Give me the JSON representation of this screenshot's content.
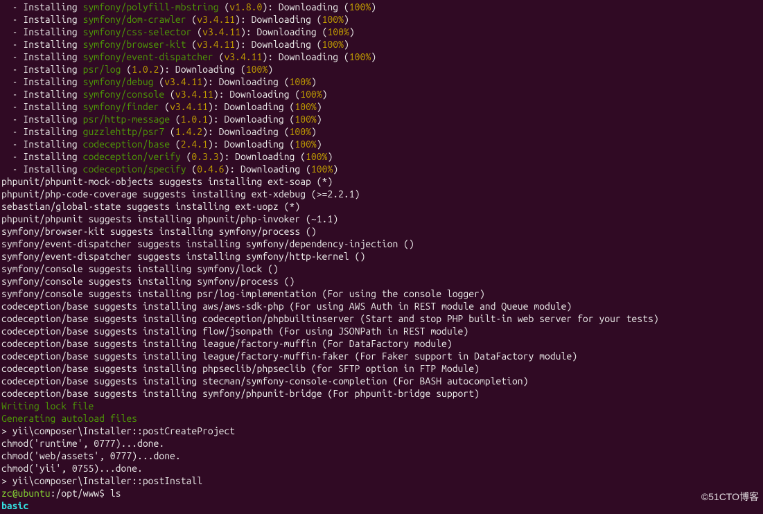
{
  "install_lines": [
    {
      "prefix": "  - Installing ",
      "package": "symfony/polyfill-mbstring",
      "open": " (",
      "version": "v1.8.0",
      "middle": "): Downloading (",
      "percent": "100%",
      "close": ")"
    },
    {
      "prefix": "  - Installing ",
      "package": "symfony/dom-crawler",
      "open": " (",
      "version": "v3.4.11",
      "middle": "): Downloading (",
      "percent": "100%",
      "close": ")"
    },
    {
      "prefix": "  - Installing ",
      "package": "symfony/css-selector",
      "open": " (",
      "version": "v3.4.11",
      "middle": "): Downloading (",
      "percent": "100%",
      "close": ")"
    },
    {
      "prefix": "  - Installing ",
      "package": "symfony/browser-kit",
      "open": " (",
      "version": "v3.4.11",
      "middle": "): Downloading (",
      "percent": "100%",
      "close": ")"
    },
    {
      "prefix": "  - Installing ",
      "package": "symfony/event-dispatcher",
      "open": " (",
      "version": "v3.4.11",
      "middle": "): Downloading (",
      "percent": "100%",
      "close": ")"
    },
    {
      "prefix": "  - Installing ",
      "package": "psr/log",
      "open": " (",
      "version": "1.0.2",
      "middle": "): Downloading (",
      "percent": "100%",
      "close": ")"
    },
    {
      "prefix": "  - Installing ",
      "package": "symfony/debug",
      "open": " (",
      "version": "v3.4.11",
      "middle": "): Downloading (",
      "percent": "100%",
      "close": ")"
    },
    {
      "prefix": "  - Installing ",
      "package": "symfony/console",
      "open": " (",
      "version": "v3.4.11",
      "middle": "): Downloading (",
      "percent": "100%",
      "close": ")"
    },
    {
      "prefix": "  - Installing ",
      "package": "symfony/finder",
      "open": " (",
      "version": "v3.4.11",
      "middle": "): Downloading (",
      "percent": "100%",
      "close": ")"
    },
    {
      "prefix": "  - Installing ",
      "package": "psr/http-message",
      "open": " (",
      "version": "1.0.1",
      "middle": "): Downloading (",
      "percent": "100%",
      "close": ")"
    },
    {
      "prefix": "  - Installing ",
      "package": "guzzlehttp/psr7",
      "open": " (",
      "version": "1.4.2",
      "middle": "): Downloading (",
      "percent": "100%",
      "close": ")"
    },
    {
      "prefix": "  - Installing ",
      "package": "codeception/base",
      "open": " (",
      "version": "2.4.1",
      "middle": "): Downloading (",
      "percent": "100%",
      "close": ")"
    },
    {
      "prefix": "  - Installing ",
      "package": "codeception/verify",
      "open": " (",
      "version": "0.3.3",
      "middle": "): Downloading (",
      "percent": "100%",
      "close": ")"
    },
    {
      "prefix": "  - Installing ",
      "package": "codeception/specify",
      "open": " (",
      "version": "0.4.6",
      "middle": "): Downloading (",
      "percent": "100%",
      "close": ")"
    }
  ],
  "suggests": [
    "phpunit/phpunit-mock-objects suggests installing ext-soap (*)",
    "phpunit/php-code-coverage suggests installing ext-xdebug (>=2.2.1)",
    "sebastian/global-state suggests installing ext-uopz (*)",
    "phpunit/phpunit suggests installing phpunit/php-invoker (~1.1)",
    "symfony/browser-kit suggests installing symfony/process ()",
    "symfony/event-dispatcher suggests installing symfony/dependency-injection ()",
    "symfony/event-dispatcher suggests installing symfony/http-kernel ()",
    "symfony/console suggests installing symfony/lock ()",
    "symfony/console suggests installing symfony/process ()",
    "symfony/console suggests installing psr/log-implementation (For using the console logger)",
    "codeception/base suggests installing aws/aws-sdk-php (For using AWS Auth in REST module and Queue module)",
    "codeception/base suggests installing codeception/phpbuiltinserver (Start and stop PHP built-in web server for your tests)",
    "codeception/base suggests installing flow/jsonpath (For using JSONPath in REST module)",
    "codeception/base suggests installing league/factory-muffin (For DataFactory module)",
    "codeception/base suggests installing league/factory-muffin-faker (For Faker support in DataFactory module)",
    "codeception/base suggests installing phpseclib/phpseclib (for SFTP option in FTP Module)",
    "codeception/base suggests installing stecman/symfony-console-completion (For BASH autocompletion)",
    "codeception/base suggests installing symfony/phpunit-bridge (For phpunit-bridge support)"
  ],
  "status": {
    "writing_lock": "Writing lock file",
    "generating_autoload": "Generating autoload files"
  },
  "post_scripts": [
    "> yii\\composer\\Installer::postCreateProject",
    "chmod('runtime', 0777)...done.",
    "chmod('web/assets', 0777)...done.",
    "chmod('yii', 0755)...done.",
    "> yii\\composer\\Installer::postInstall"
  ],
  "prompt": {
    "userhost": "zc@ubuntu",
    "sep": ":",
    "cwd": "/opt/www",
    "dollar": "$ ",
    "command": "ls"
  },
  "ls_output": "basic",
  "watermark": "©51CTO博客"
}
